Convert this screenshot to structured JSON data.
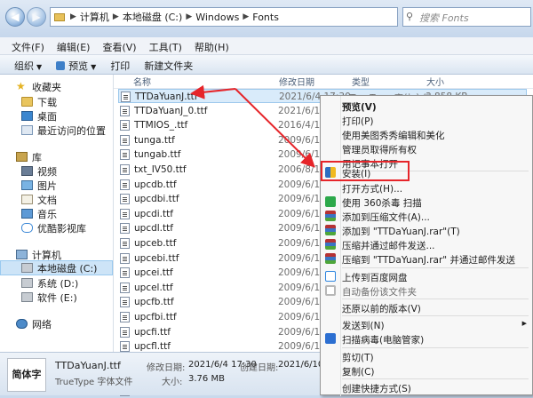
{
  "address": {
    "crumbs": [
      "计算机",
      "本地磁盘 (C:)",
      "Windows",
      "Fonts"
    ],
    "search_placeholder": "搜索 Fonts"
  },
  "menubar": [
    "文件(F)",
    "编辑(E)",
    "查看(V)",
    "工具(T)",
    "帮助(H)"
  ],
  "toolbar": {
    "organize": "组织",
    "preview": "预览",
    "print": "打印",
    "new_folder": "新建文件夹"
  },
  "sidebar": {
    "favorites": "收藏夹",
    "downloads": "下载",
    "desktop": "桌面",
    "recent": "最近访问的位置",
    "library": "库",
    "videos": "视频",
    "pictures": "图片",
    "documents": "文档",
    "music": "音乐",
    "youku": "优酷影视库",
    "computer": "计算机",
    "drive_c": "本地磁盘 (C:)",
    "drive_d": "系统 (D:)",
    "drive_e": "软件 (E:)",
    "network": "网络"
  },
  "columns": {
    "name": "名称",
    "date": "修改日期",
    "type": "类型",
    "size": "大小"
  },
  "files": [
    {
      "name": "TTDaYuanJ.ttf",
      "date": "2021/6/4 17:30",
      "type": "TrueType 字体文件",
      "size": "3,858 KB"
    },
    {
      "name": "TTDaYuanJ_0.ttf",
      "date": "2021/6/10 1",
      "type": "",
      "size": ""
    },
    {
      "name": "TTMIOS_.ttf",
      "date": "2016/4/15 1",
      "type": "",
      "size": ""
    },
    {
      "name": "tunga.ttf",
      "date": "2009/6/11 1",
      "type": "",
      "size": ""
    },
    {
      "name": "tungab.ttf",
      "date": "2009/6/11 1",
      "type": "",
      "size": ""
    },
    {
      "name": "txt_IV50.ttf",
      "date": "2006/8/1 1",
      "type": "",
      "size": ""
    },
    {
      "name": "upcdb.ttf",
      "date": "2009/6/11 1",
      "type": "",
      "size": ""
    },
    {
      "name": "upcdbi.ttf",
      "date": "2009/6/11 1",
      "type": "",
      "size": ""
    },
    {
      "name": "upcdi.ttf",
      "date": "2009/6/11 1",
      "type": "",
      "size": ""
    },
    {
      "name": "upcdl.ttf",
      "date": "2009/6/11 1",
      "type": "",
      "size": ""
    },
    {
      "name": "upceb.ttf",
      "date": "2009/6/11 1",
      "type": "",
      "size": ""
    },
    {
      "name": "upcebi.ttf",
      "date": "2009/6/11 1",
      "type": "",
      "size": ""
    },
    {
      "name": "upcei.ttf",
      "date": "2009/6/11 1",
      "type": "",
      "size": ""
    },
    {
      "name": "upcel.ttf",
      "date": "2009/6/11 1",
      "type": "",
      "size": ""
    },
    {
      "name": "upcfb.ttf",
      "date": "2009/6/11 1",
      "type": "",
      "size": ""
    },
    {
      "name": "upcfbi.ttf",
      "date": "2009/6/11 1",
      "type": "",
      "size": ""
    },
    {
      "name": "upcfi.ttf",
      "date": "2009/6/11 1",
      "type": "",
      "size": ""
    },
    {
      "name": "upcfl.ttf",
      "date": "2009/6/11 1",
      "type": "",
      "size": ""
    },
    {
      "name": "upcib.ttf",
      "date": "2009/6/11 1",
      "type": "",
      "size": ""
    },
    {
      "name": "upcibi.ttf",
      "date": "2009/6/11 1",
      "type": "",
      "size": ""
    },
    {
      "name": "upcii.ttf",
      "date": "2009/6/11 1",
      "type": "",
      "size": ""
    }
  ],
  "details": {
    "thumb": "简体字",
    "filename": "TTDaYuanJ.ttf",
    "type_line": "TrueType 字体文件",
    "modified_label": "修改日期:",
    "modified": "2021/6/4 17:30",
    "created_label": "创建日期:",
    "created": "2021/6/10 1",
    "size_label": "大小:",
    "size": "3.76 MB"
  },
  "context_menu": {
    "preview": "预览(V)",
    "print": "打印(P)",
    "meitu": "使用美图秀秀编辑和美化",
    "admin": "管理员取得所有权",
    "notepad": "用记事本打开",
    "install": "安装(I)",
    "open_with": "打开方式(H)...",
    "scan_360": "使用 360杀毒 扫描",
    "add_archive": "添加到压缩文件(A)...",
    "add_rar": "添加到 \"TTDaYuanJ.rar\"(T)",
    "compress_email": "压缩并通过邮件发送...",
    "compress_rar_email": "压缩到 \"TTDaYuanJ.rar\" 并通过邮件发送",
    "baidu": "上传到百度网盘",
    "autobackup": "自动备份该文件夹",
    "restore": "还原以前的版本(V)",
    "send_to": "发送到(N)",
    "scan_tencent": "扫描病毒(电脑管家)",
    "cut": "剪切(T)",
    "copy": "复制(C)",
    "shortcut": "创建快捷方式(S)"
  },
  "colors": {
    "highlight_red": "#e6252a",
    "selection": "#d9ebfa"
  }
}
